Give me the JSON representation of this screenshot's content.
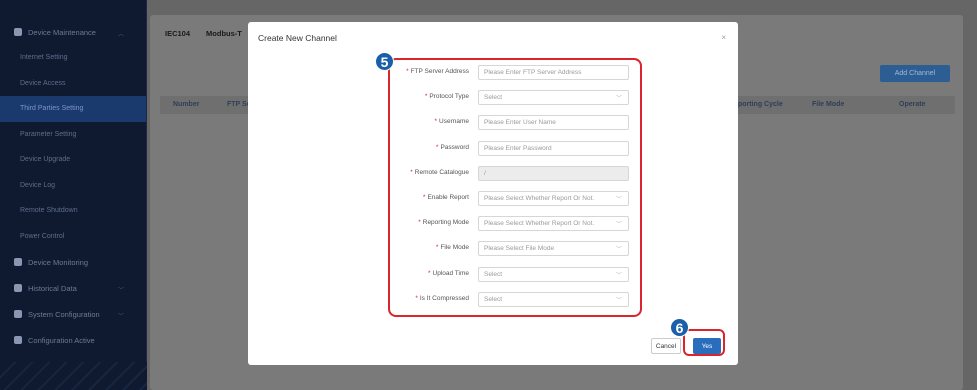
{
  "sidebar": {
    "groups": [
      {
        "label": "Device Maintenance",
        "icon": "shield-icon"
      },
      {
        "label": "Device Monitoring",
        "icon": "monitor-icon"
      },
      {
        "label": "Historical Data",
        "icon": "database-icon"
      },
      {
        "label": "System Configuration",
        "icon": "gear-icon"
      },
      {
        "label": "Configuration Active",
        "icon": "save-icon"
      }
    ],
    "items": [
      {
        "label": "Internet Setting"
      },
      {
        "label": "Device Access"
      },
      {
        "label": "Third Parties Setting"
      },
      {
        "label": "Parameter Setting"
      },
      {
        "label": "Device Upgrade"
      },
      {
        "label": "Device Log"
      },
      {
        "label": "Remote Shutdown"
      },
      {
        "label": "Power Control"
      }
    ]
  },
  "tabs": [
    "IEC104",
    "Modbus-T"
  ],
  "add_channel_label": "Add Channel",
  "table": {
    "headers": [
      "Number",
      "FTP Se",
      "porting Cycle",
      "File Mode",
      "Operate"
    ]
  },
  "modal": {
    "title": "Create New Channel",
    "close_icon": "×",
    "fields": [
      {
        "label": "FTP Server Address",
        "placeholder": "Please Enter FTP Server Address",
        "type": "input"
      },
      {
        "label": "Protocol Type",
        "placeholder": "Select",
        "type": "select"
      },
      {
        "label": "Username",
        "placeholder": "Please Enter User Name",
        "type": "input"
      },
      {
        "label": "Password",
        "placeholder": "Please Enter Password",
        "type": "input"
      },
      {
        "label": "Remote Catalogue",
        "value": "/",
        "type": "disabled"
      },
      {
        "label": "Enable Report",
        "placeholder": "Please Select Whether Report Or Not.",
        "type": "select"
      },
      {
        "label": "Reporting Mode",
        "placeholder": "Please Select Whether Report Or Not.",
        "type": "select"
      },
      {
        "label": "File Mode",
        "placeholder": "Please Select File Mode",
        "type": "select"
      },
      {
        "label": "Upload Time",
        "placeholder": "Select",
        "type": "select"
      },
      {
        "label": "Is It Compressed",
        "placeholder": "Select",
        "type": "select"
      }
    ],
    "cancel_label": "Cancel",
    "yes_label": "Yes"
  },
  "annotations": {
    "step_five": "5",
    "step_six": "6"
  },
  "colors": {
    "highlight": "#d9252b",
    "primary": "#2b6dbd",
    "badge": "#1a5faa"
  }
}
